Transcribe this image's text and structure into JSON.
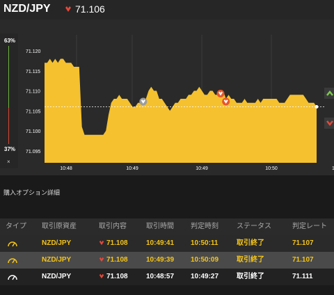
{
  "header": {
    "pair": "NZD/JPY",
    "rate": "71.106",
    "direction": "down"
  },
  "indicator": {
    "high_pct": "63%",
    "low_pct": "37%",
    "close_symbol": "×"
  },
  "chart_data": {
    "type": "area",
    "y_ticks": [
      "71.120",
      "71.115",
      "71.110",
      "71.105",
      "71.100",
      "71.095"
    ],
    "ylim": [
      71.092,
      71.124
    ],
    "x_ticks": [
      "10:48",
      "10:49",
      "10:49",
      "10:50",
      "1"
    ],
    "current_rate": 71.106,
    "values": [
      71.117,
      71.117,
      71.118,
      71.117,
      71.118,
      71.117,
      71.118,
      71.118,
      71.117,
      71.117,
      71.117,
      71.116,
      71.116,
      71.116,
      71.101,
      71.099,
      71.099,
      71.099,
      71.099,
      71.099,
      71.099,
      71.099,
      71.099,
      71.1,
      71.104,
      71.107,
      71.108,
      71.108,
      71.109,
      71.108,
      71.108,
      71.108,
      71.107,
      71.106,
      71.106,
      71.107,
      71.107,
      71.108,
      71.108,
      71.11,
      71.111,
      71.11,
      71.11,
      71.108,
      71.108,
      71.107,
      71.106,
      71.105,
      71.106,
      71.107,
      71.107,
      71.108,
      71.108,
      71.108,
      71.109,
      71.109,
      71.11,
      71.11,
      71.111,
      71.11,
      71.109,
      71.109,
      71.11,
      71.11,
      71.109,
      71.109,
      71.11,
      71.11,
      71.108,
      71.109,
      71.108,
      71.108,
      71.107,
      71.107,
      71.107,
      71.108,
      71.107,
      71.107,
      71.107,
      71.107,
      71.108,
      71.107,
      71.108,
      71.108,
      71.108,
      71.108,
      71.108,
      71.108,
      71.107,
      71.107,
      71.107,
      71.108,
      71.109,
      71.109,
      71.109,
      71.109,
      71.109,
      71.109,
      71.108,
      71.107,
      71.107,
      71.107,
      71.106
    ],
    "fill_color": "#f5c12e",
    "markers": [
      {
        "x_index": 37,
        "color": "#9c9c9c"
      },
      {
        "x_index": 66,
        "color": "#e8552a"
      },
      {
        "x_index": 68,
        "color": "#e8552a"
      }
    ]
  },
  "section_title": "購入オプション詳細",
  "table": {
    "headers": [
      "タイプ",
      "取引原資産",
      "取引内容",
      "取引時間",
      "判定時刻",
      "ステータス",
      "判定レート"
    ],
    "rows": [
      {
        "asset": "NZD/JPY",
        "content": "71.108",
        "trade_time": "10:49:41",
        "judge_time": "10:50:11",
        "status": "取引終了",
        "judge_rate": "71.107",
        "style": "yellow"
      },
      {
        "asset": "NZD/JPY",
        "content": "71.108",
        "trade_time": "10:49:39",
        "judge_time": "10:50:09",
        "status": "取引終了",
        "judge_rate": "71.107",
        "style": "yellow"
      },
      {
        "asset": "NZD/JPY",
        "content": "71.108",
        "trade_time": "10:48:57",
        "judge_time": "10:49:27",
        "status": "取引終了",
        "judge_rate": "71.111",
        "style": "white"
      }
    ]
  },
  "colors": {
    "accent": "#f5c518",
    "down": "#e24a3b",
    "up": "#7ec850"
  }
}
